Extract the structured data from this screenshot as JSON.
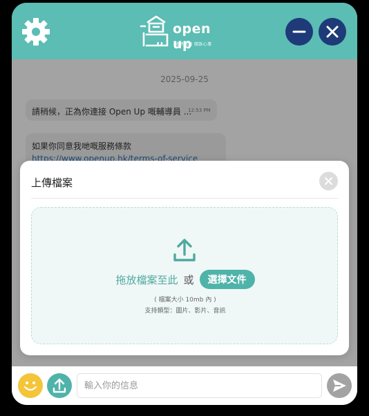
{
  "header": {
    "logo_text": "open up",
    "logo_tagline": "隨時隨地 傾訴心事",
    "icons": [
      "gear-icon",
      "minimize-icon",
      "close-icon"
    ],
    "color": "#5bbdb4",
    "button_color": "#1e3a78"
  },
  "chat": {
    "date": "2025-09-25",
    "messages": [
      {
        "text": "請稍候，正為你連接 Open Up 嘅輔導員 ...",
        "time": "12:53 PM"
      },
      {
        "text": "如果你同意我哋嘅服務條款",
        "link": "https://www.openup.hk/terms-of-service"
      }
    ]
  },
  "modal": {
    "title": "上傳檔案",
    "drop_text": "拖放檔案至此",
    "or_text": "或",
    "choose_label": "選擇文件",
    "limit_text": "( 檔案大小 10mb 內 )",
    "types_text": "支持類型：圖片、影片、音訊",
    "accent": "#4fb3aa"
  },
  "footer": {
    "input_placeholder": "輸入你的信息",
    "icons": [
      "smile-icon",
      "upload-icon",
      "send-icon"
    ]
  }
}
